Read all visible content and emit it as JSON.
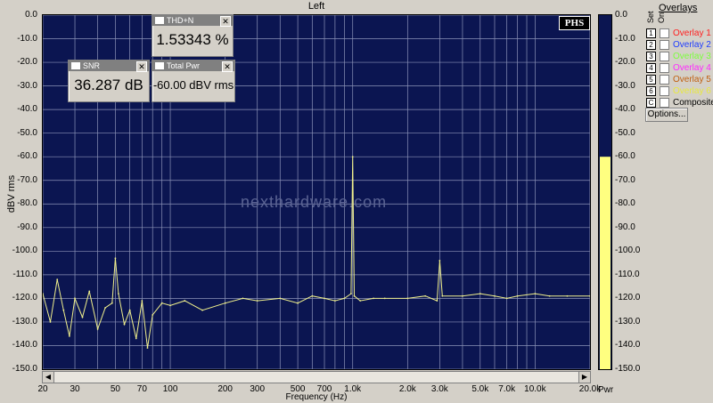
{
  "window": {
    "title": "Left"
  },
  "axes": {
    "ylabel": "dBV rms",
    "xlabel": "Frequency (Hz)",
    "y_ticks": [
      "0.0",
      "-10.0",
      "-20.0",
      "-30.0",
      "-40.0",
      "-50.0",
      "-60.0",
      "-70.0",
      "-80.0",
      "-90.0",
      "-100.0",
      "-110.0",
      "-120.0",
      "-130.0",
      "-140.0",
      "-150.0"
    ],
    "y_ticks_right": [
      "0.0",
      "-10.0",
      "-20.0",
      "-30.0",
      "-40.0",
      "-50.0",
      "-60.0",
      "-70.0",
      "-80.0",
      "-90.0",
      "-100.0",
      "-110.0",
      "-120.0",
      "-130.0",
      "-140.0",
      "-150.0"
    ],
    "x_ticks": [
      "20",
      "30",
      "50",
      "70",
      "100",
      "200",
      "300",
      "500",
      "700",
      "1.0k",
      "2.0k",
      "3.0k",
      "5.0k",
      "7.0k",
      "10.0k",
      "20.0k"
    ],
    "pwr_label": "Pwr"
  },
  "meters": {
    "thd": {
      "title": "THD+N",
      "value": "1.53343 %"
    },
    "snr": {
      "title": "SNR",
      "value": "36.287 dB"
    },
    "total_pwr": {
      "title": "Total Pwr",
      "value": "-60.00 dBV rms"
    }
  },
  "overlays": {
    "title": "Overlays",
    "set_label": "Set",
    "on_label": "On",
    "items": [
      {
        "num": "1",
        "label": "Overlay 1",
        "color": "#ff2020"
      },
      {
        "num": "2",
        "label": "Overlay 2",
        "color": "#1e3cff"
      },
      {
        "num": "3",
        "label": "Overlay 3",
        "color": "#7cff3c"
      },
      {
        "num": "4",
        "label": "Overlay 4",
        "color": "#ff28ff"
      },
      {
        "num": "5",
        "label": "Overlay 5",
        "color": "#c06010"
      },
      {
        "num": "6",
        "label": "Overlay 6",
        "color": "#e8e840"
      },
      {
        "num": "C",
        "label": "Composite",
        "color": "#000000"
      }
    ],
    "options_label": "Options..."
  },
  "brand": {
    "phs": "PHS",
    "watermark": "nexthardware.com"
  },
  "colors": {
    "plot_bg": "#0b1551",
    "trace": "#f0f08c",
    "meter_fill": "#ffff80",
    "grid": "#8c93b8"
  },
  "chart_data": {
    "type": "line",
    "xlabel": "Frequency (Hz)",
    "ylabel": "dBV rms",
    "xscale": "log",
    "xlim": [
      20,
      20000
    ],
    "ylim": [
      -150,
      0
    ],
    "grid": true,
    "power_level_dbv": -60.0,
    "series": [
      {
        "x": [
          20,
          22,
          24,
          26,
          28,
          30,
          33,
          36,
          40,
          44,
          48,
          50,
          52,
          56,
          60,
          65,
          70,
          75,
          80,
          90,
          100,
          120,
          150,
          200,
          250,
          300,
          400,
          500,
          600,
          700,
          800,
          900,
          980,
          1000,
          1020,
          1100,
          1300,
          1500,
          2000,
          2500,
          2900,
          3000,
          3100,
          4000,
          5000,
          6000,
          7000,
          8000,
          10000,
          12000,
          15000,
          20000
        ],
        "y": [
          -118,
          -130,
          -112,
          -125,
          -136,
          -120,
          -128,
          -117,
          -133,
          -124,
          -122,
          -103,
          -118,
          -131,
          -125,
          -137,
          -121,
          -141,
          -127,
          -122,
          -123,
          -121,
          -125,
          -122,
          -120,
          -121,
          -120,
          -122,
          -119,
          -120,
          -121,
          -120,
          -118,
          -60,
          -119,
          -121,
          -120,
          -120,
          -120,
          -119,
          -121,
          -104,
          -119,
          -119,
          -118,
          -119,
          -120,
          -119,
          -118,
          -119,
          -119,
          -119
        ]
      }
    ]
  }
}
